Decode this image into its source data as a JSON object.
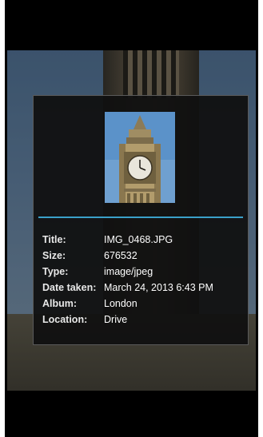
{
  "details_dialog": {
    "rows": [
      {
        "label": "Title:",
        "value": "IMG_0468.JPG"
      },
      {
        "label": "Size:",
        "value": "676532"
      },
      {
        "label": "Type:",
        "value": "image/jpeg"
      },
      {
        "label": "Date taken:",
        "value": "March 24, 2013 6:43 PM"
      },
      {
        "label": "Album:",
        "value": "London"
      },
      {
        "label": "Location:",
        "value": "Drive"
      }
    ],
    "accent_color": "#3aa0c9"
  }
}
